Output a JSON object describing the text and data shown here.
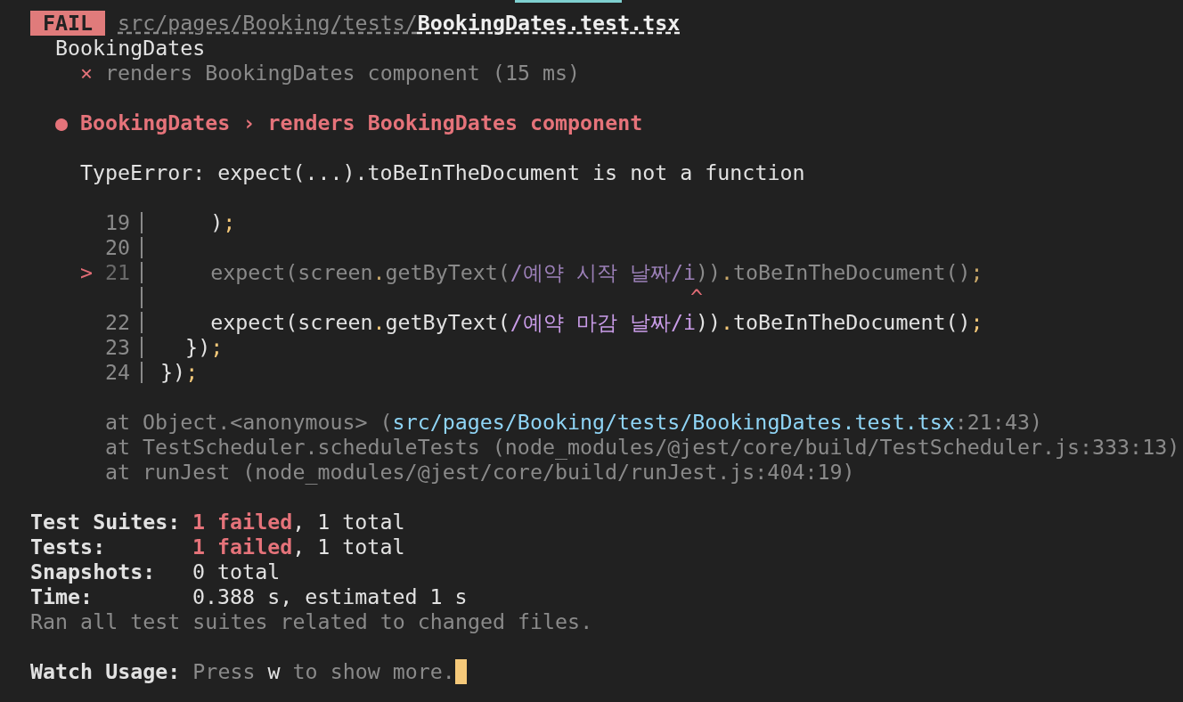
{
  "header": {
    "badge": "FAIL",
    "path_dir": "src/pages/Booking/tests/",
    "path_file": "BookingDates.test.tsx"
  },
  "suite": "BookingDates",
  "test_result": {
    "mark": "×",
    "name": "renders BookingDates component (15 ms)"
  },
  "failure_title": {
    "bullet": "●",
    "text": "BookingDates › renders BookingDates component"
  },
  "error_message": "TypeError: expect(...).toBeInTheDocument is not a function",
  "code_frame": [
    {
      "kind": "code",
      "line_number": "19",
      "dimmed": false,
      "tokens": [
        {
          "kind": "plain",
          "text": "    )"
        },
        {
          "kind": "punct",
          "text": ";"
        }
      ]
    },
    {
      "kind": "code",
      "line_number": "20",
      "dimmed": false
    },
    {
      "kind": "code",
      "marker": ">",
      "line_number": "21",
      "dimmed": true,
      "tokens": [
        {
          "kind": "plain",
          "text": "    expect(screen"
        },
        {
          "kind": "punct",
          "text": "."
        },
        {
          "kind": "plain",
          "text": "getByText("
        },
        {
          "kind": "regex",
          "text": "/예약 시작 날짜/i"
        },
        {
          "kind": "plain",
          "text": "))"
        },
        {
          "kind": "punct",
          "text": "."
        },
        {
          "kind": "plain",
          "text": "toBeInTheDocument()"
        },
        {
          "kind": "punct",
          "text": ";"
        }
      ]
    },
    {
      "kind": "caret",
      "caret": "^"
    },
    {
      "kind": "code",
      "line_number": "22",
      "dimmed": false,
      "tokens": [
        {
          "kind": "plain",
          "text": "    expect(screen"
        },
        {
          "kind": "punct",
          "text": "."
        },
        {
          "kind": "plain",
          "text": "getByText("
        },
        {
          "kind": "regex",
          "text": "/예약 마감 날짜/i"
        },
        {
          "kind": "plain",
          "text": "))"
        },
        {
          "kind": "punct",
          "text": "."
        },
        {
          "kind": "plain",
          "text": "toBeInTheDocument()"
        },
        {
          "kind": "punct",
          "text": ";"
        }
      ]
    },
    {
      "kind": "code",
      "line_number": "23",
      "dimmed": false,
      "tokens": [
        {
          "kind": "plain",
          "text": "  })"
        },
        {
          "kind": "punct",
          "text": ";"
        }
      ]
    },
    {
      "kind": "code",
      "line_number": "24",
      "dimmed": false,
      "tokens": [
        {
          "kind": "plain",
          "text": "})"
        },
        {
          "kind": "punct",
          "text": ";"
        }
      ]
    }
  ],
  "stack_trace": [
    [
      {
        "kind": "dim",
        "text": "at Object.<anonymous> ("
      },
      {
        "kind": "path",
        "text": "src/pages/Booking/tests/BookingDates.test.tsx"
      },
      {
        "kind": "dim",
        "text": ":21:43)"
      }
    ],
    [
      {
        "kind": "dim",
        "text": "at TestScheduler.scheduleTests (node_modules/@jest/core/build/TestScheduler.js:333:13)"
      }
    ],
    [
      {
        "kind": "dim",
        "text": "at runJest (node_modules/@jest/core/build/runJest.js:404:19)"
      }
    ]
  ],
  "summary": [
    {
      "label": "Test Suites:",
      "value": [
        {
          "kind": "fail",
          "text": "1 failed"
        },
        {
          "kind": "plain",
          "text": ", 1 total"
        }
      ]
    },
    {
      "label": "Tests:",
      "value": [
        {
          "kind": "fail",
          "text": "1 failed"
        },
        {
          "kind": "plain",
          "text": ", 1 total"
        }
      ]
    },
    {
      "label": "Snapshots:",
      "value": [
        {
          "kind": "plain",
          "text": "0 total"
        }
      ]
    },
    {
      "label": "Time:",
      "value": [
        {
          "kind": "plain",
          "text": "0.388 s, estimated 1 s"
        }
      ]
    }
  ],
  "summary_note": "Ran all test suites related to changed files.",
  "watch_usage": {
    "label": "Watch Usage:",
    "value": [
      {
        "kind": "dim",
        "text": "Press "
      },
      {
        "kind": "plain",
        "text": "w"
      },
      {
        "kind": "dim",
        "text": " to show more."
      }
    ]
  }
}
